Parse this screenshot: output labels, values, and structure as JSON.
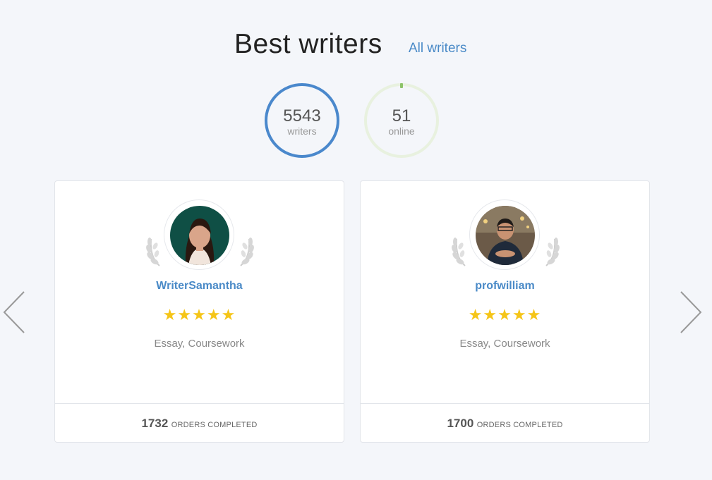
{
  "header": {
    "title": "Best writers",
    "all_link": "All writers"
  },
  "stats": {
    "writers_count": "5543",
    "writers_label": "writers",
    "online_count": "51",
    "online_label": "online"
  },
  "colors": {
    "accent": "#4a88cc",
    "link": "#4a8ac7",
    "star": "#f5c518",
    "online_ring": "#e8f1df",
    "online_tick": "#8dc36a"
  },
  "cards": [
    {
      "name": "WriterSamantha",
      "stars": "★★★★★",
      "rating": 5,
      "subjects": "Essay, Coursework",
      "orders_count": "1732",
      "orders_label": "ORDERS COMPLETED"
    },
    {
      "name": "profwilliam",
      "stars": "★★★★★",
      "rating": 5,
      "subjects": "Essay, Coursework",
      "orders_count": "1700",
      "orders_label": "ORDERS COMPLETED"
    }
  ],
  "icons": {
    "prev": "chevron-left-icon",
    "next": "chevron-right-icon",
    "laurel": "laurel-icon"
  }
}
